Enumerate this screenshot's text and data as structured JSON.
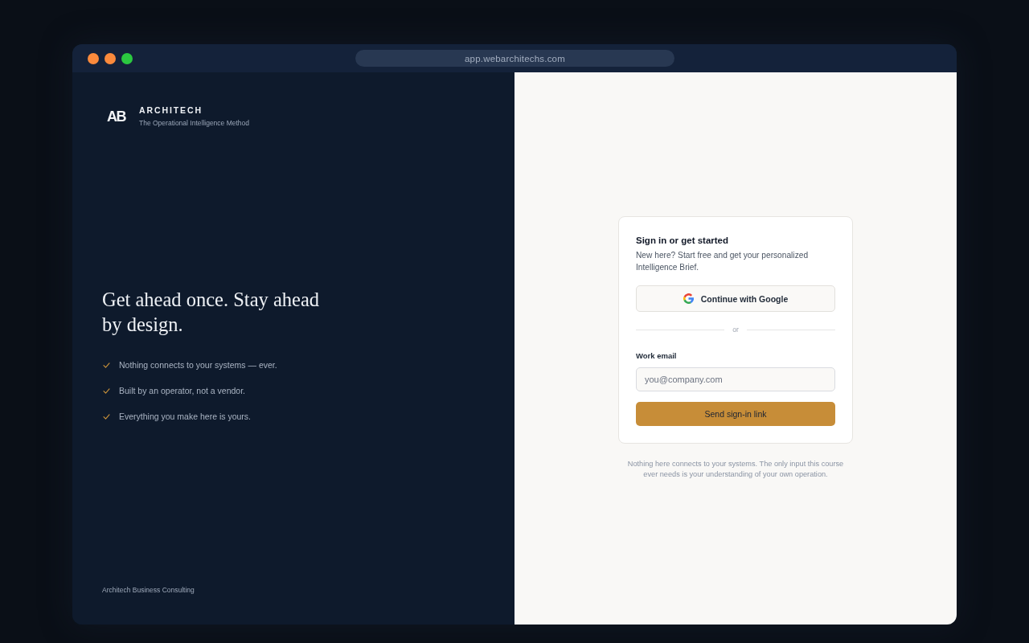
{
  "window": {
    "url": "app.webarchitechs.com"
  },
  "brand_panel": {
    "logo_mark": "AB",
    "name": "ARCHITECH",
    "tagline": "The Operational Intelligence Method",
    "headline": "Get ahead once. Stay ahead by design.",
    "features": [
      "Nothing connects to your systems — ever.",
      "Built by an operator, not a vendor.",
      "Everything you make here is yours."
    ],
    "footer": "Architech Business Consulting"
  },
  "sign_in": {
    "title": "Sign in or get started",
    "subtitle": "New here? Start free and get your personalized Intelligence Brief.",
    "google_button": "Continue with Google",
    "divider": "or",
    "email_label": "Work email",
    "email_field": {
      "placeholder": "you@company.com"
    },
    "submit_button": "Send sign-in link",
    "note": "Nothing here connects to your systems. The only input this course ever needs is your understanding of your own operation."
  }
}
